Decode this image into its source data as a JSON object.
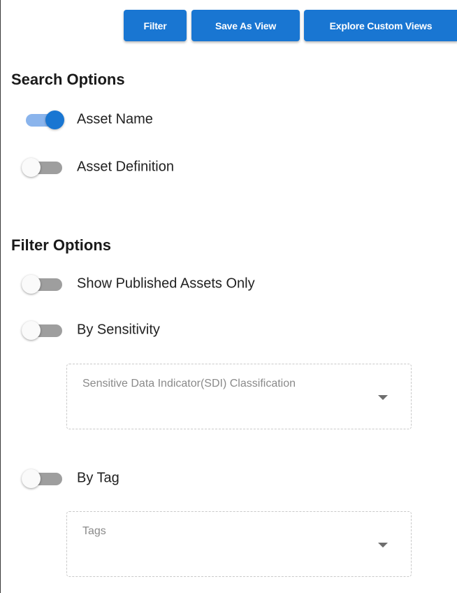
{
  "toolbar": {
    "filter_label": "Filter",
    "save_view_label": "Save As View",
    "explore_views_label": "Explore Custom Views"
  },
  "search_options": {
    "title": "Search Options",
    "items": [
      {
        "label": "Asset Name",
        "enabled": true
      },
      {
        "label": "Asset Definition",
        "enabled": false
      }
    ]
  },
  "filter_options": {
    "title": "Filter Options",
    "published_only": {
      "label": "Show Published Assets Only",
      "enabled": false
    },
    "sensitivity": {
      "label": "By Sensitivity",
      "enabled": false,
      "select_placeholder": "Sensitive Data Indicator(SDI) Classification"
    },
    "tag": {
      "label": "By Tag",
      "enabled": false,
      "select_placeholder": "Tags"
    }
  },
  "colors": {
    "primary": "#1976d2",
    "toggle_on_track": "#8ab4ec",
    "toggle_off_track": "#9e9e9e"
  },
  "icons": {
    "dropdown": "caret-down-icon"
  }
}
